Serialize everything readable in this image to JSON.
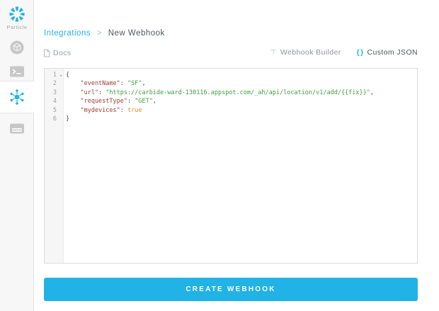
{
  "app": {
    "accent": "#21b2e6"
  },
  "brand": {
    "name": "Particle",
    "logo_icon": "particle-star-icon"
  },
  "sidebar": {
    "items": [
      {
        "name": "devices",
        "icon": "cube-icon",
        "active": false
      },
      {
        "name": "console",
        "icon": "terminal-icon",
        "active": false
      },
      {
        "name": "integrations",
        "icon": "hub-icon",
        "active": true
      },
      {
        "name": "sim-cards",
        "icon": "sim-card-icon",
        "active": false
      }
    ]
  },
  "breadcrumb": {
    "parent": "Integrations",
    "separator": ">",
    "current": "New Webhook"
  },
  "toolbar": {
    "docs": "Docs",
    "tabs": [
      {
        "label": "Webhook Builder",
        "icon": "builder-icon",
        "active": false
      },
      {
        "label": "Custom JSON",
        "icon": "braces-icon",
        "active": true
      }
    ]
  },
  "editor": {
    "colors": {
      "plain": "#4d4d4c",
      "key": "#9e3c34",
      "string": "#3fa03f",
      "boolean": "#ee8a2e"
    },
    "lines": [
      {
        "num": "1",
        "fold": true,
        "tokens": [
          {
            "type": "plain",
            "text": "{"
          }
        ]
      },
      {
        "num": "2",
        "tokens": [
          {
            "type": "key",
            "text": "    \"eventName\""
          },
          {
            "type": "plain",
            "text": ": "
          },
          {
            "type": "string",
            "text": "\"SF\""
          },
          {
            "type": "plain",
            "text": ","
          }
        ]
      },
      {
        "num": "3",
        "tokens": [
          {
            "type": "key",
            "text": "    \"url\""
          },
          {
            "type": "plain",
            "text": ": "
          },
          {
            "type": "string",
            "text": "\"https://carbide-ward-130116.appspot.com/_ah/api/location/v1/add/{{fix}}\""
          },
          {
            "type": "plain",
            "text": ","
          }
        ]
      },
      {
        "num": "4",
        "tokens": [
          {
            "type": "key",
            "text": "    \"requestType\""
          },
          {
            "type": "plain",
            "text": ": "
          },
          {
            "type": "string",
            "text": "\"GET\""
          },
          {
            "type": "plain",
            "text": ","
          }
        ]
      },
      {
        "num": "5",
        "tokens": [
          {
            "type": "key",
            "text": "    \"mydevices\""
          },
          {
            "type": "plain",
            "text": ": "
          },
          {
            "type": "boolean",
            "text": "true"
          }
        ]
      },
      {
        "num": "6",
        "tokens": [
          {
            "type": "plain",
            "text": "}"
          }
        ]
      }
    ]
  },
  "actions": {
    "create": "CREATE WEBHOOK"
  }
}
